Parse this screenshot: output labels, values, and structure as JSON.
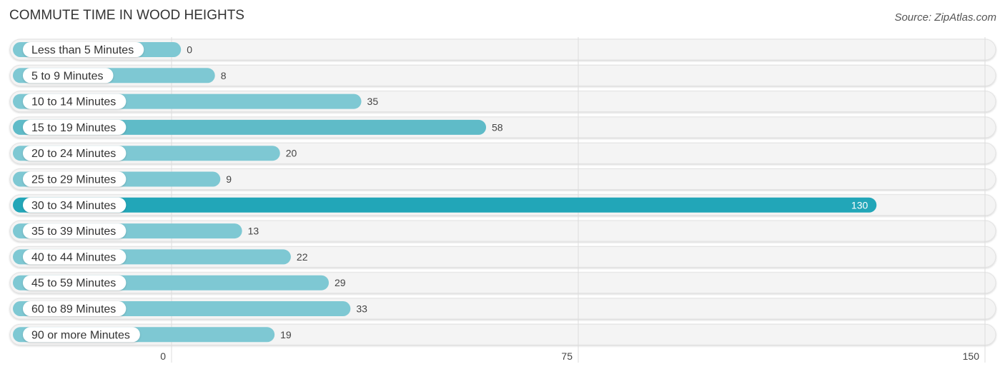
{
  "chart_data": {
    "type": "bar",
    "orientation": "horizontal",
    "title": "COMMUTE TIME IN WOOD HEIGHTS",
    "source": "Source: ZipAtlas.com",
    "categories": [
      "Less than 5 Minutes",
      "5 to 9 Minutes",
      "10 to 14 Minutes",
      "15 to 19 Minutes",
      "20 to 24 Minutes",
      "25 to 29 Minutes",
      "30 to 34 Minutes",
      "35 to 39 Minutes",
      "40 to 44 Minutes",
      "45 to 59 Minutes",
      "60 to 89 Minutes",
      "90 or more Minutes"
    ],
    "values": [
      0,
      8,
      35,
      58,
      20,
      9,
      130,
      13,
      22,
      29,
      33,
      19
    ],
    "xlim": [
      0,
      150
    ],
    "xticks": [
      0,
      75,
      150
    ],
    "xlabel": "",
    "ylabel": "",
    "grid": true,
    "highlight_index": 6,
    "colors": {
      "bar": "#7ec8d3",
      "bar_highlight": "#22a6b8",
      "track": "#f3f3f3",
      "label_bg": "#ffffff"
    }
  }
}
